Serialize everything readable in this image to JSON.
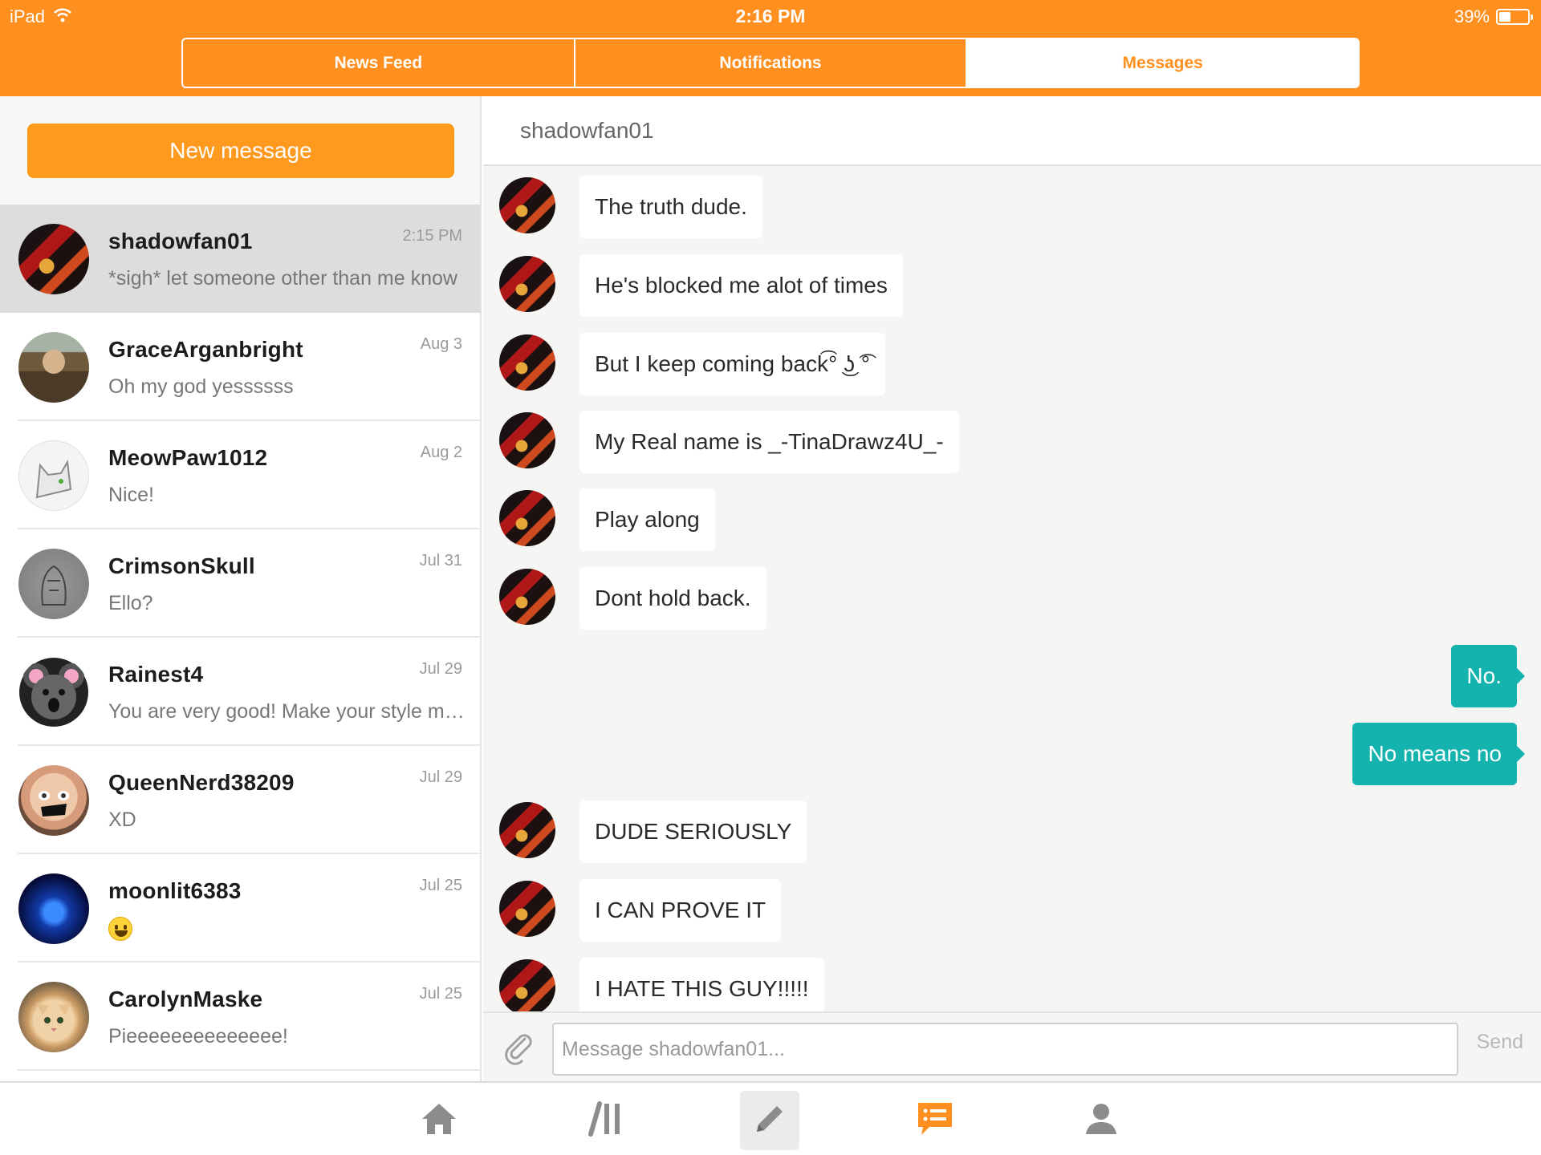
{
  "status_bar": {
    "device": "iPad",
    "time": "2:16 PM",
    "battery": "39%",
    "battery_level": 0.39
  },
  "top_tabs": [
    {
      "label": "News Feed",
      "active": false
    },
    {
      "label": "Notifications",
      "active": false
    },
    {
      "label": "Messages",
      "active": true
    }
  ],
  "sidebar": {
    "new_message_label": "New message",
    "conversations": [
      {
        "name": "shadowfan01",
        "date": "2:15 PM",
        "preview": "*sigh* let someone other than me know",
        "selected": true
      },
      {
        "name": "GraceArganbright",
        "date": "Aug 3",
        "preview": "Oh my god yessssss"
      },
      {
        "name": "MeowPaw1012",
        "date": "Aug 2",
        "preview": "Nice!"
      },
      {
        "name": "CrimsonSkull",
        "date": "Jul 31",
        "preview": "Ello?"
      },
      {
        "name": "Rainest4",
        "date": "Jul 29",
        "preview": "You are very good! Make your style more"
      },
      {
        "name": "QueenNerd38209",
        "date": "Jul 29",
        "preview": "XD"
      },
      {
        "name": "moonlit6383",
        "date": "Jul 25",
        "preview": "",
        "preview_icon": "grinning-face-emoji"
      },
      {
        "name": "CarolynMaske",
        "date": "Jul 25",
        "preview": "Pieeeeeeeeeeeeee!"
      }
    ]
  },
  "chat": {
    "title": "shadowfan01",
    "messages": [
      {
        "from": "shadowfan01",
        "text": "The truth dude."
      },
      {
        "from": "shadowfan01",
        "text": "He's blocked me alot of times"
      },
      {
        "from": "shadowfan01",
        "text": "But I keep coming back͡° ͜ʖ ͡°"
      },
      {
        "from": "shadowfan01",
        "text": "My Real name is _-TinaDrawz4U_-"
      },
      {
        "from": "shadowfan01",
        "text": "Play along"
      },
      {
        "from": "shadowfan01",
        "text": "Dont hold back."
      },
      {
        "from": "me",
        "text": "No."
      },
      {
        "from": "me",
        "text": "No means no"
      },
      {
        "from": "shadowfan01",
        "text": "DUDE SERIOUSLY"
      },
      {
        "from": "shadowfan01",
        "text": "I CAN PROVE IT"
      },
      {
        "from": "shadowfan01",
        "text": "I HATE THIS GUY!!!!!"
      }
    ]
  },
  "composer": {
    "placeholder": "Message shadowfan01...",
    "send_label": "Send"
  },
  "bottom_tabs": [
    {
      "icon": "home-icon",
      "active": false
    },
    {
      "icon": "library-icon",
      "active": false
    },
    {
      "icon": "pencil-icon",
      "pressed": true
    },
    {
      "icon": "messages-icon",
      "active": true
    },
    {
      "icon": "profile-icon",
      "active": false
    }
  ],
  "colors": {
    "brand_orange": "#ff8f1f",
    "outgoing_bubble": "#14b3ae",
    "icon_gray": "#8c8c8c"
  }
}
